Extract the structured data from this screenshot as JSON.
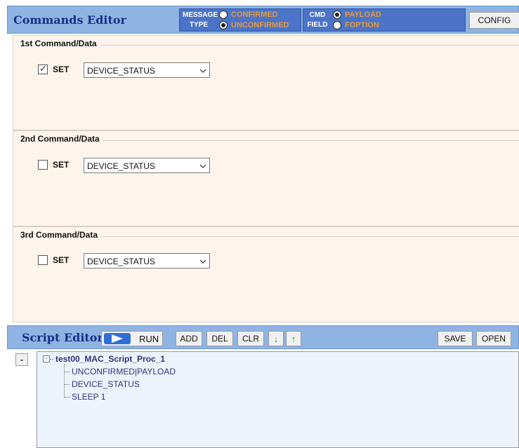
{
  "commands_editor": {
    "title": "Commands Editor",
    "message_type": {
      "caption_line1": "MESSAGE",
      "caption_line2": "TYPE",
      "options": [
        "CONFIRMED",
        "UNCONFIRMED"
      ],
      "selected": "UNCONFIRMED"
    },
    "cmd_field": {
      "caption_line1": "CMD",
      "caption_line2": "FIELD",
      "options": [
        "PAYLOAD",
        "FOPTION"
      ],
      "selected": "PAYLOAD"
    },
    "config_label": "CONFIG",
    "groups": [
      {
        "title": "1st Command/Data",
        "set_label": "SET",
        "checked": true,
        "value": "DEVICE_STATUS"
      },
      {
        "title": "2nd Command/Data",
        "set_label": "SET",
        "checked": false,
        "value": "DEVICE_STATUS"
      },
      {
        "title": "3rd Command/Data",
        "set_label": "SET",
        "checked": false,
        "value": "DEVICE_STATUS"
      }
    ]
  },
  "script_editor": {
    "title": "Script Editor",
    "run_label": "RUN",
    "add_label": "ADD",
    "del_label": "DEL",
    "clr_label": "CLR",
    "down_arrow": "↓",
    "up_arrow": "↑",
    "save_label": "SAVE",
    "open_label": "OPEN",
    "collapse_label": "-",
    "tree": {
      "root_expander": "-",
      "root": "test00_MAC_Script_Proc_1",
      "children": [
        "UNCONFIRMED|PAYLOAD",
        "DEVICE_STATUS",
        "SLEEP 1"
      ]
    }
  },
  "colors": {
    "header_bg": "#8fb4e3",
    "title_text": "#1b2f86",
    "option_box_bg": "#4b74c8",
    "option_text": "#e89a3c",
    "panel_bg": "#fdf5ec",
    "tree_bg": "#edf3fb",
    "arrow_green": "#2e9e2e"
  }
}
